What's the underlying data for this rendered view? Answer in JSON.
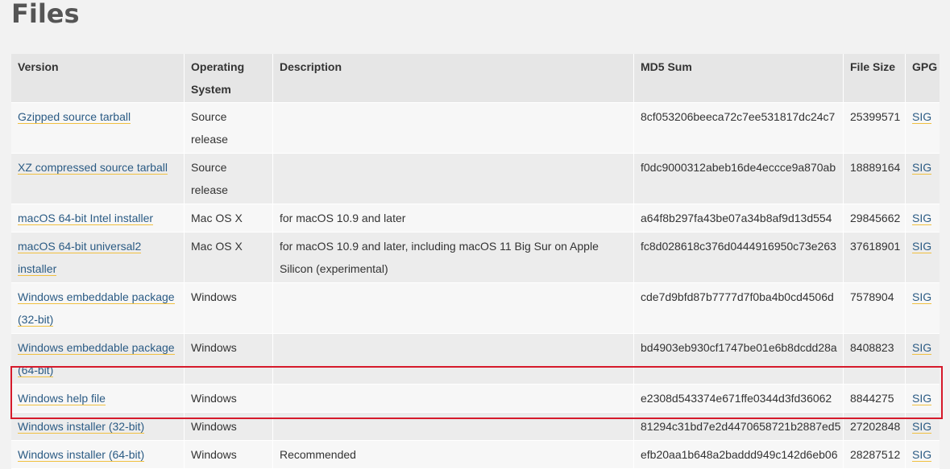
{
  "page": {
    "title": "Files"
  },
  "table": {
    "headers": [
      "Version",
      "Operating System",
      "Description",
      "MD5 Sum",
      "File Size",
      "GPG"
    ],
    "rows": [
      {
        "version": "Gzipped source tarball",
        "os": "Source release",
        "description": "",
        "md5": "8cf053206beeca72c7ee531817dc24c7",
        "size": "25399571",
        "gpg": "SIG"
      },
      {
        "version": "XZ compressed source tarball",
        "os": "Source release",
        "description": "",
        "md5": "f0dc9000312abeb16de4eccce9a870ab",
        "size": "18889164",
        "gpg": "SIG"
      },
      {
        "version": "macOS 64-bit Intel installer",
        "os": "Mac OS X",
        "description": "for macOS 10.9 and later",
        "md5": "a64f8b297fa43be07a34b8af9d13d554",
        "size": "29845662",
        "gpg": "SIG"
      },
      {
        "version": "macOS 64-bit universal2 installer",
        "os": "Mac OS X",
        "description": "for macOS 10.9 and later, including macOS 11 Big Sur on Apple Silicon (experimental)",
        "md5": "fc8d028618c376d0444916950c73e263",
        "size": "37618901",
        "gpg": "SIG"
      },
      {
        "version": "Windows embeddable package (32-bit)",
        "os": "Windows",
        "description": "",
        "md5": "cde7d9bfd87b7777d7f0ba4b0cd4506d",
        "size": "7578904",
        "gpg": "SIG"
      },
      {
        "version": "Windows embeddable package (64-bit)",
        "os": "Windows",
        "description": "",
        "md5": "bd4903eb930cf1747be01e6b8dcdd28a",
        "size": "8408823",
        "gpg": "SIG"
      },
      {
        "version": "Windows help file",
        "os": "Windows",
        "description": "",
        "md5": "e2308d543374e671ffe0344d3fd36062",
        "size": "8844275",
        "gpg": "SIG"
      },
      {
        "version": "Windows installer (32-bit)",
        "os": "Windows",
        "description": "",
        "md5": "81294c31bd7e2d4470658721b2887ed5",
        "size": "27202848",
        "gpg": "SIG"
      },
      {
        "version": "Windows installer (64-bit)",
        "os": "Windows",
        "description": "Recommended",
        "md5": "efb20aa1b648a2baddd949c142d6eb06",
        "size": "28287512",
        "gpg": "SIG"
      }
    ]
  },
  "colors": {
    "link": "#2b5b84",
    "link_underline": "#f0c040",
    "highlight": "#d61a2b",
    "header_bg": "#e6e6e6"
  }
}
